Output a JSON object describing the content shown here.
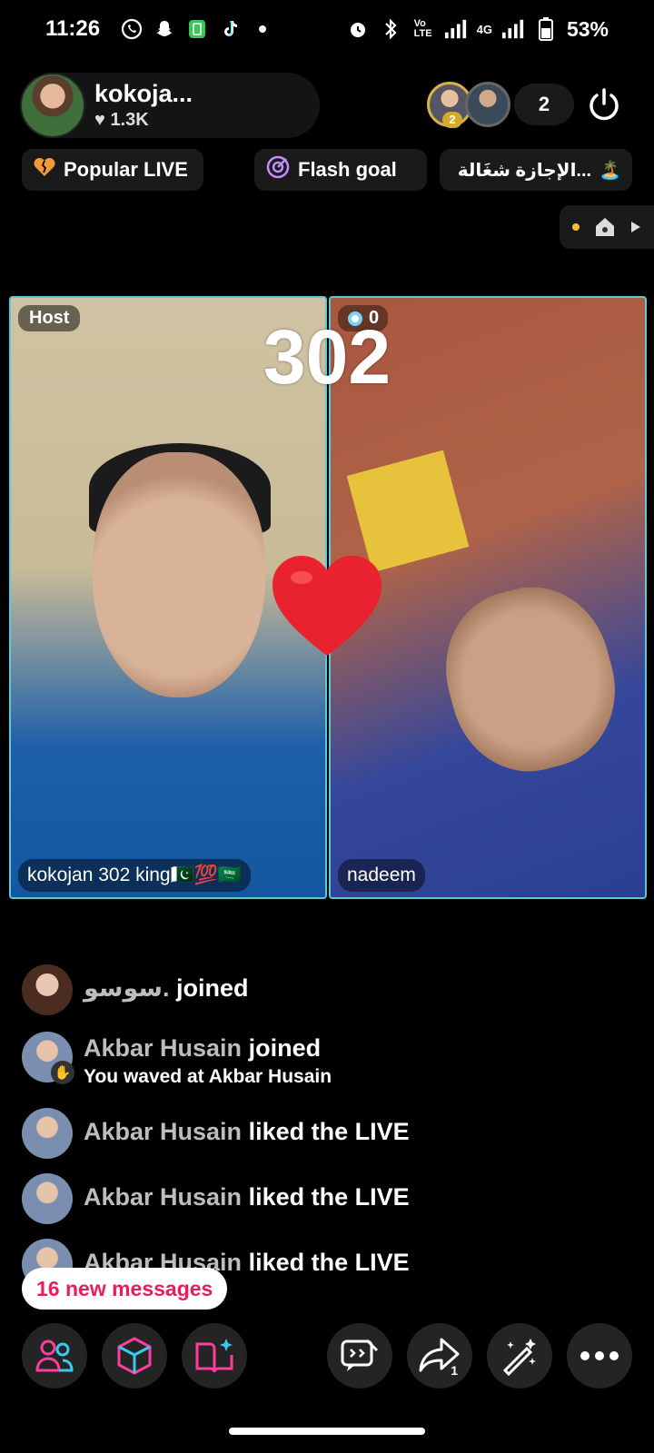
{
  "status_bar": {
    "time": "11:26",
    "network_label": "4G",
    "battery": "53%"
  },
  "header": {
    "host_name": "kokoja...",
    "host_likes": "1.3K",
    "viewer_badge": "2",
    "viewer_count": "2"
  },
  "chips": {
    "popular": "Popular LIVE",
    "flash_goal": "Flash goal",
    "arabic": "...الإجازة شغَالة"
  },
  "battle": {
    "score": "302",
    "host_tag": "Host",
    "opponent_score": "0",
    "host_display_name": "kokojan 302 king🇵🇰💯🇸🇦",
    "opponent_name": "nadeem"
  },
  "chat": [
    {
      "user": "سوسو.",
      "action": "joined",
      "sub": ""
    },
    {
      "user": "Akbar Husain",
      "action": "joined",
      "sub": "You waved at Akbar Husain"
    },
    {
      "user": "Akbar Husain",
      "action": "liked the LIVE",
      "sub": ""
    },
    {
      "user": "Akbar Husain",
      "action": "liked the LIVE",
      "sub": ""
    },
    {
      "user": "Akbar Husain",
      "action": "liked the LIVE",
      "sub": ""
    }
  ],
  "new_messages": "16 new messages",
  "toolbar": {
    "icons": [
      "guests-icon",
      "cube-icon",
      "book-sparkle-icon",
      "chat-toggle-icon",
      "share-icon",
      "magic-wand-icon",
      "more-icon"
    ],
    "share_badge": "1"
  },
  "colors": {
    "accent": "#e61f5a",
    "panel_border": "#5cc9d6",
    "heart": "#e8232f"
  }
}
